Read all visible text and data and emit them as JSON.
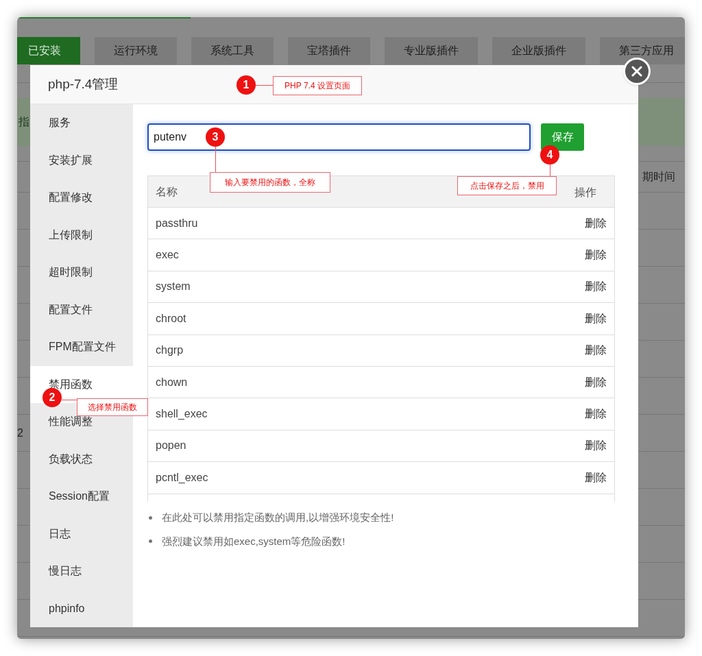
{
  "background": {
    "tabs": [
      {
        "label": "已安装",
        "selected": true
      },
      {
        "label": "运行环境",
        "selected": false
      },
      {
        "label": "系统工具",
        "selected": false
      },
      {
        "label": "宝塔插件",
        "selected": false
      },
      {
        "label": "专业版插件",
        "selected": false
      },
      {
        "label": "企业版插件",
        "selected": false
      },
      {
        "label": "第三方应用",
        "selected": false
      }
    ],
    "progress": {
      "level": 0.26
    },
    "banner_text": "指",
    "column_header": "期时间",
    "row_text": "2"
  },
  "modal": {
    "title": "php-7.4管理",
    "sidebar": [
      {
        "label": "服务",
        "selected": false
      },
      {
        "label": "安装扩展",
        "selected": false
      },
      {
        "label": "配置修改",
        "selected": false
      },
      {
        "label": "上传限制",
        "selected": false
      },
      {
        "label": "超时限制",
        "selected": false
      },
      {
        "label": "配置文件",
        "selected": false
      },
      {
        "label": "FPM配置文件",
        "selected": false
      },
      {
        "label": "禁用函数",
        "selected": true
      },
      {
        "label": "性能调整",
        "selected": false
      },
      {
        "label": "负载状态",
        "selected": false
      },
      {
        "label": "Session配置",
        "selected": false
      },
      {
        "label": "日志",
        "selected": false
      },
      {
        "label": "慢日志",
        "selected": false
      },
      {
        "label": "phpinfo",
        "selected": false
      }
    ],
    "input": {
      "value": "putenv"
    },
    "save_button": "保存",
    "table": {
      "columns": [
        "名称",
        "操作"
      ],
      "rows": [
        {
          "name": "passthru",
          "action": "删除"
        },
        {
          "name": "exec",
          "action": "删除"
        },
        {
          "name": "system",
          "action": "删除"
        },
        {
          "name": "chroot",
          "action": "删除"
        },
        {
          "name": "chgrp",
          "action": "删除"
        },
        {
          "name": "chown",
          "action": "删除"
        },
        {
          "name": "shell_exec",
          "action": "删除"
        },
        {
          "name": "popen",
          "action": "删除"
        },
        {
          "name": "pcntl_exec",
          "action": "删除"
        }
      ]
    },
    "notes": [
      "在此处可以禁用指定函数的调用,以增强环境安全性!",
      "强烈建议禁用如exec,system等危险函数!"
    ]
  },
  "annotations": [
    {
      "number": "1",
      "text": "PHP 7.4 设置页面"
    },
    {
      "number": "2",
      "text": "选择禁用函数"
    },
    {
      "number": "3",
      "text": "输入要禁用的函数，全称"
    },
    {
      "number": "4",
      "text": "点击保存之后，禁用"
    }
  ]
}
